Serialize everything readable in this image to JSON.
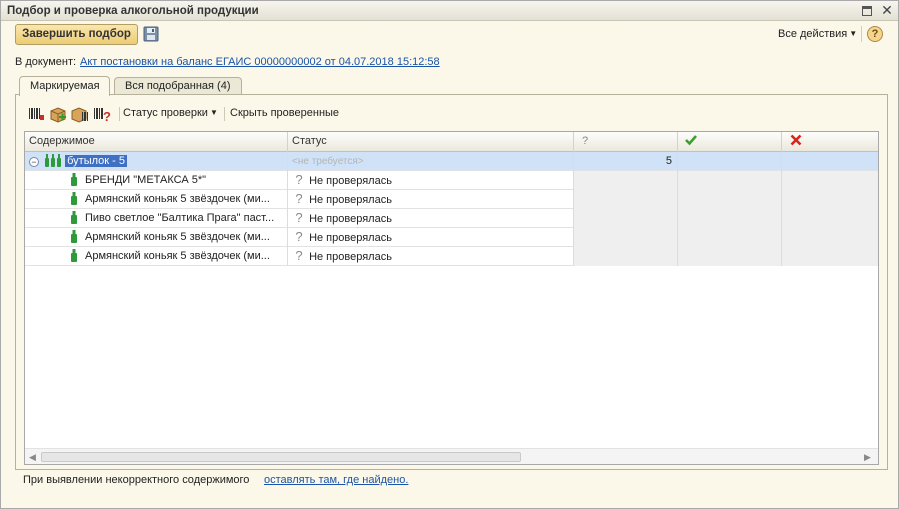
{
  "window": {
    "title": "Подбор и проверка алкогольной продукции"
  },
  "toolbar": {
    "finish_label": "Завершить подбор",
    "all_actions_label": "Все действия",
    "help_glyph": "?"
  },
  "document": {
    "label": "В документ:",
    "link_text": "Акт постановки на баланс ЕГАИС 00000000002 от 04.07.2018 15:12:58"
  },
  "tabs": [
    {
      "label": "Маркируемая",
      "active": true
    },
    {
      "label": "Вся подобранная (4)",
      "active": false
    }
  ],
  "panel_toolbar": {
    "status_check_label": "Статус проверки",
    "hide_checked_label": "Скрыть проверенные"
  },
  "grid": {
    "columns": {
      "content": "Содержимое",
      "status": "Статус",
      "unknown": "?",
      "ok_icon": "check-icon",
      "error_icon": "cross-icon"
    },
    "group_row": {
      "label": "бутылок -  5",
      "status_placeholder": "<не требуется>",
      "unknown_count": "5"
    },
    "rows": [
      {
        "name": "БРЕНДИ \"МЕТАКСА 5*\"",
        "status": "Не проверялась"
      },
      {
        "name": "Армянский коньяк 5 звёздочек (ми...",
        "status": "Не проверялась"
      },
      {
        "name": "Пиво светлое \"Балтика Прага\" паст...",
        "status": "Не проверялась"
      },
      {
        "name": "Армянский коньяк 5 звёздочек (ми...",
        "status": "Не проверялась"
      },
      {
        "name": "Армянский коньяк 5 звёздочек (ми...",
        "status": "Не проверялась"
      }
    ]
  },
  "footer": {
    "label": "При выявлении некорректного содержимого",
    "link_text": "оставлять там, где найдено."
  },
  "colors": {
    "accent_button": "#f0d282",
    "selection": "#3f70c4",
    "link": "#1b54a8",
    "ok": "#3aa02c",
    "error": "#d8261c"
  }
}
